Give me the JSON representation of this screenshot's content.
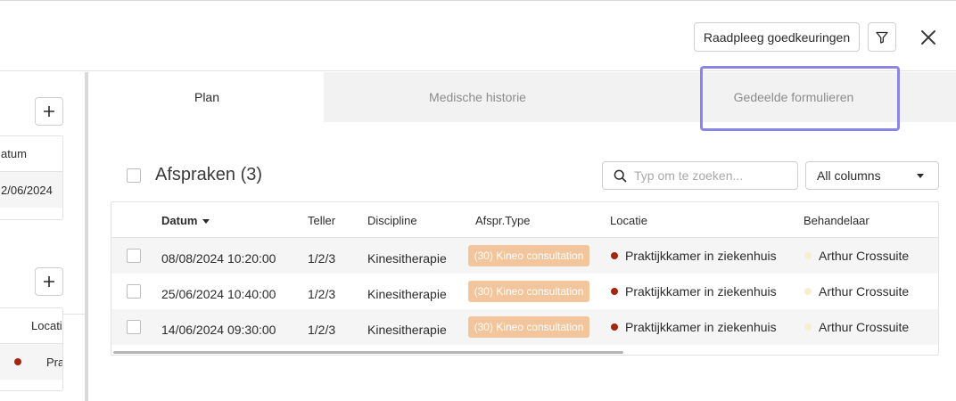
{
  "header": {
    "approvals_label": "Raadpleeg goedkeuringen",
    "filter_icon": "filter-icon",
    "close_icon": "close-icon"
  },
  "left_panel": {
    "card1": {
      "header": "atum",
      "value": "2/06/2024"
    },
    "card2": {
      "header": "Locati",
      "value": "Pra"
    }
  },
  "tabs": [
    {
      "label": "Plan",
      "active": true
    },
    {
      "label": "Medische historie",
      "active": false
    },
    {
      "label": "Gedeelde formulieren",
      "active": false
    }
  ],
  "appointments": {
    "title": "Afspraken (3)",
    "search_placeholder": "Typ om te zoeken...",
    "column_select": "All columns",
    "columns": [
      "Datum",
      "Teller",
      "Discipline",
      "Afspr.Type",
      "Locatie",
      "Behandelaar"
    ],
    "rows": [
      {
        "datum": "08/08/2024 10:20:00",
        "teller": "1/2/3",
        "discipline": "Kinesitherapie",
        "type": "(30) Kineo consultation",
        "locatie": "Praktijkkamer in ziekenhuis",
        "behandelaar": "Arthur Crossuite"
      },
      {
        "datum": "25/06/2024 10:40:00",
        "teller": "1/2/3",
        "discipline": "Kinesitherapie",
        "type": "(30) Kineo consultation",
        "locatie": "Praktijkkamer in ziekenhuis",
        "behandelaar": "Arthur Crossuite"
      },
      {
        "datum": "14/06/2024 09:30:00",
        "teller": "1/2/3",
        "discipline": "Kinesitherapie",
        "type": "(30) Kineo consultation",
        "locatie": "Praktijkkamer in ziekenhuis",
        "behandelaar": "Arthur Crossuite"
      }
    ]
  },
  "colors": {
    "badge": "#f2c59c",
    "location_dot": "#a3260f",
    "practitioner_dot": "#f7efcf",
    "focus_ring": "#8a86e8"
  }
}
